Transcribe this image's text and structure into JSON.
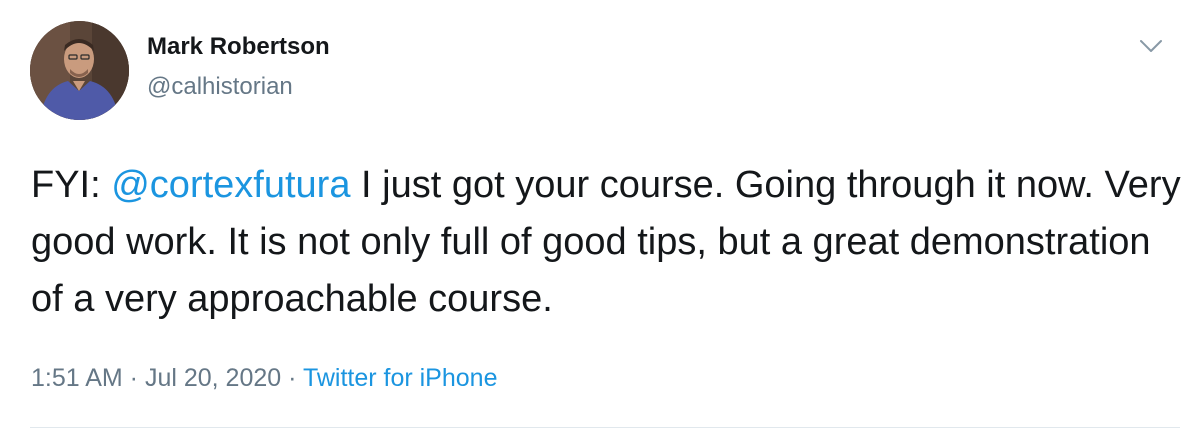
{
  "tweet": {
    "user": {
      "name": "Mark Robertson",
      "handle": "@calhistorian",
      "avatar_icon": "profile-photo"
    },
    "menu_icon": "chevron-down-icon",
    "text": {
      "prefix": "FYI: ",
      "mention": "@cortexfutura",
      "body": " I just got your course. Going through it now. Very good work. It is not only full of good tips, but a great demonstration of a very approachable course."
    },
    "meta": {
      "time": "1:51 AM",
      "separator": " · ",
      "date": "Jul 20, 2020",
      "source": "Twitter for iPhone"
    }
  },
  "colors": {
    "link": "#1b95e0",
    "text": "#14171a",
    "secondary": "#657786",
    "divider": "#e1e8ed"
  }
}
